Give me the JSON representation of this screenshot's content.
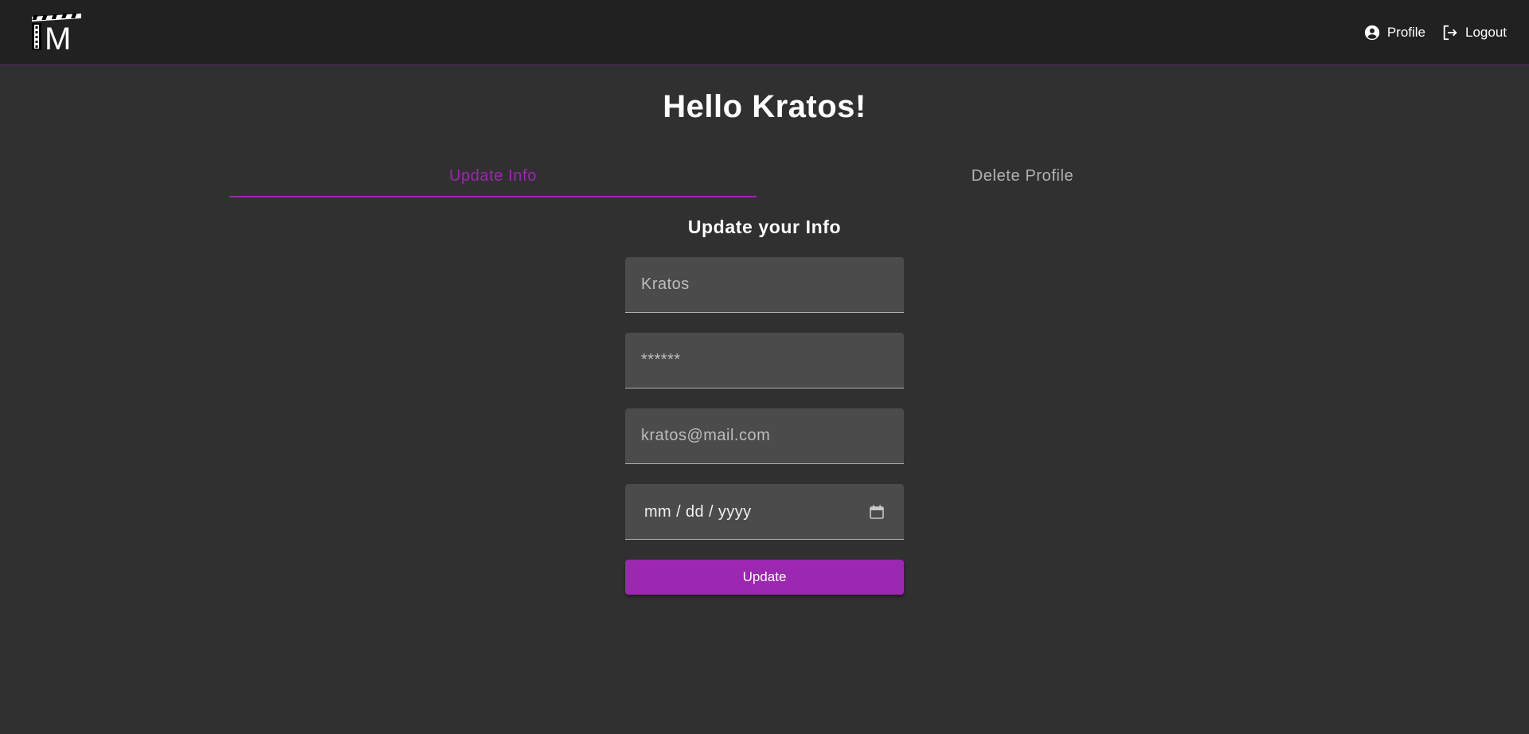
{
  "header": {
    "logo_text": "TM",
    "nav": [
      {
        "label": "Profile",
        "icon": "account-circle-icon"
      },
      {
        "label": "Logout",
        "icon": "logout-icon"
      }
    ]
  },
  "page": {
    "title": "Hello Kratos!"
  },
  "tabs": [
    {
      "label": "Update Info",
      "active": true
    },
    {
      "label": "Delete Profile",
      "active": false
    }
  ],
  "form": {
    "title": "Update your Info",
    "username_placeholder": "Kratos",
    "password_placeholder": "******",
    "email_placeholder": "kratos@mail.com",
    "date_placeholder": "mm / dd / yyyy",
    "submit_label": "Update"
  },
  "colors": {
    "accent": "#9c27b0",
    "background": "#303030",
    "header_background": "#212121",
    "field_background": "#4b4b4b"
  }
}
